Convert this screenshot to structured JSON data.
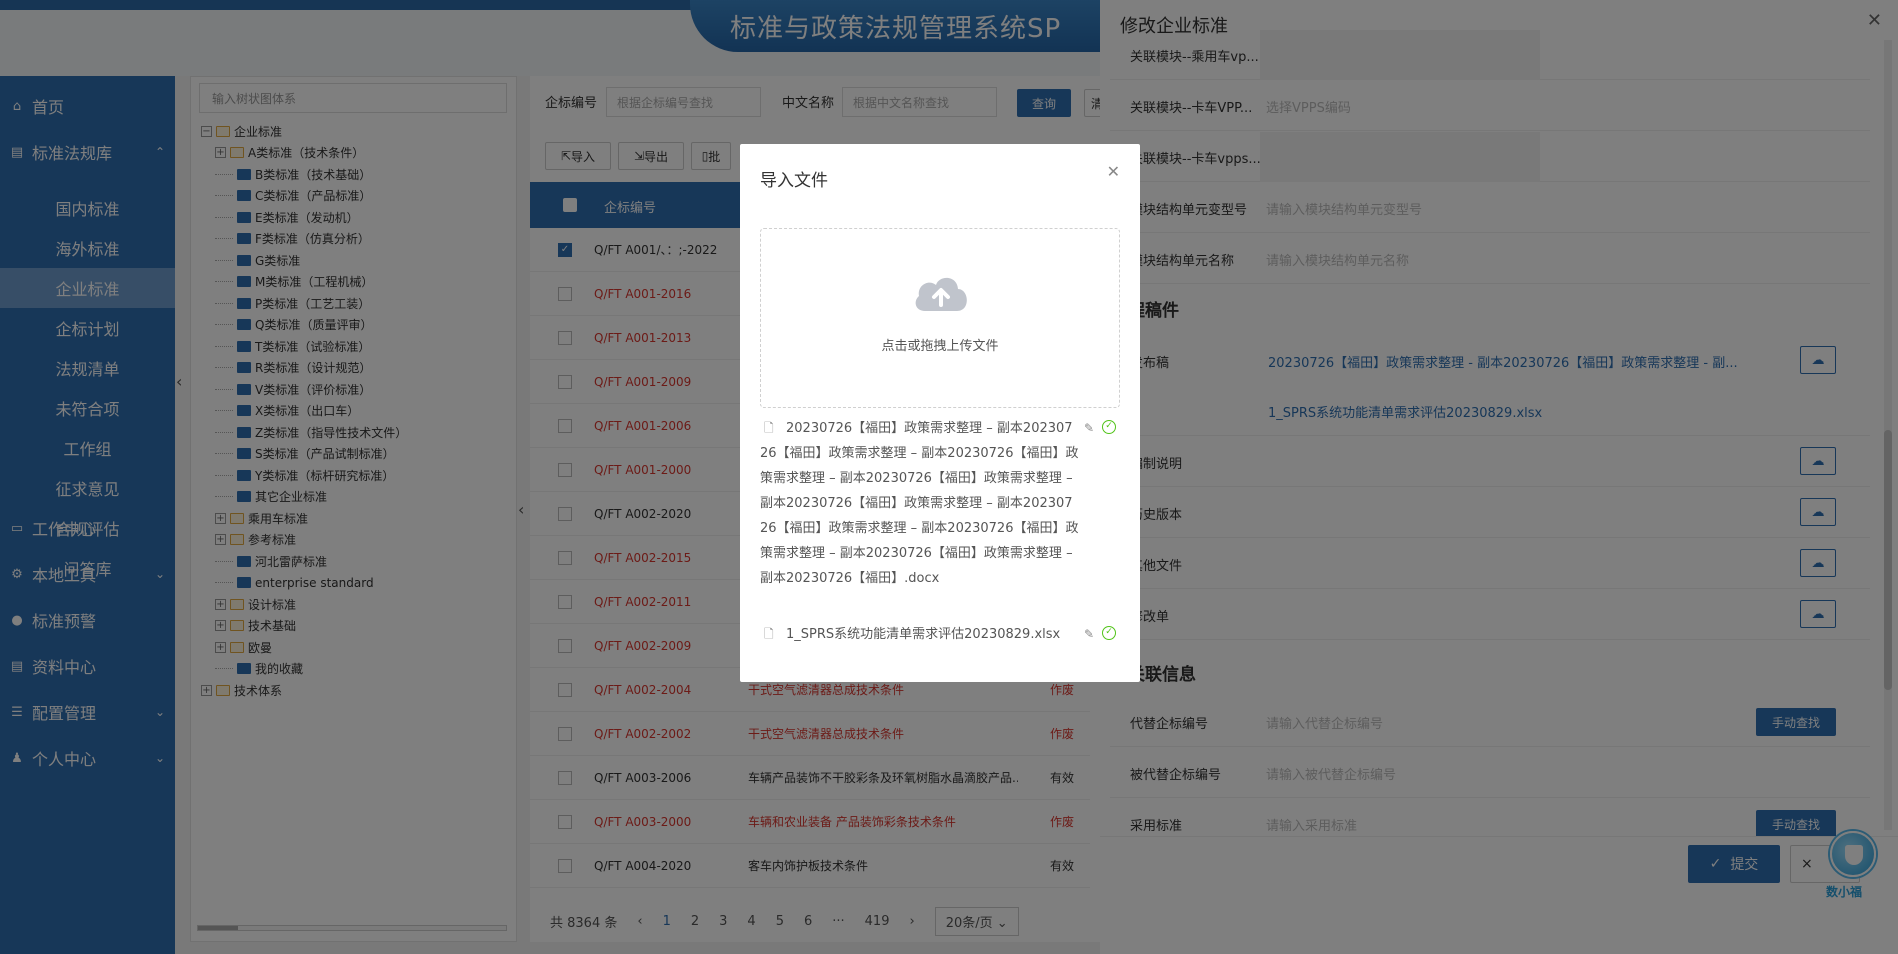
{
  "app": {
    "title": "标准与政策法规管理系统SP"
  },
  "sidebar": {
    "items": [
      {
        "icon": "home-icon",
        "label": "首页",
        "glyph": "⌂"
      },
      {
        "icon": "book-icon",
        "label": "标准法规库",
        "glyph": "▤",
        "expanded": true
      },
      {
        "icon": "monitor-icon",
        "label": "工作中心",
        "glyph": "▭"
      },
      {
        "icon": "gear-icon",
        "label": "本地工具",
        "glyph": "⚙"
      },
      {
        "icon": "alert-icon",
        "label": "标准预警",
        "glyph": "●"
      },
      {
        "icon": "document-icon",
        "label": "资料中心",
        "glyph": "▤"
      },
      {
        "icon": "sliders-icon",
        "label": "配置管理",
        "glyph": "☰"
      },
      {
        "icon": "person-icon",
        "label": "个人中心",
        "glyph": "♟"
      }
    ],
    "subitems": [
      "国内标准",
      "海外标准",
      "企业标准",
      "企标计划",
      "法规清单",
      "未符合项",
      "工作组",
      "征求意见",
      "合规评估",
      "问答库"
    ],
    "active_subitem": "企业标准"
  },
  "tree": {
    "search_placeholder": "输入树状图体系",
    "nodes": [
      "企业标准",
      "A类标准（技术条件）",
      "B类标准（技术基础）",
      "C类标准（产品标准）",
      "E类标准（发动机）",
      "F类标准（仿真分析）",
      "G类标准",
      "M类标准（工程机械）",
      "P类标准（工艺工装）",
      "Q类标准（质量评审）",
      "T类标准（试验标准）",
      "R类标准（设计规范）",
      "V类标准（评价标准）",
      "X类标准（出口车）",
      "Z类标准（指导性技术文件）",
      "S类标准（产品试制标准）",
      "Y类标准（标杆研究标准）",
      "其它企业标准",
      "乘用车标准",
      "参考标准",
      "河北雷萨标准",
      "enterprise standard",
      "设计标准",
      "技术基础",
      "欧曼",
      "我的收藏",
      "技术体系"
    ]
  },
  "search": {
    "code_label": "企标编号",
    "code_placeholder": "根据企标编号查找",
    "name_label": "中文名称",
    "name_placeholder": "根据中文名称查找",
    "query_button": "查询",
    "cut_button": "清"
  },
  "toolbar": {
    "import": "导入",
    "export": "导出",
    "batch": "批"
  },
  "table": {
    "header_code": "企标编号",
    "rows": [
      {
        "code": "Q/FT A001/、：;-2022",
        "name": "",
        "status": "",
        "red": false,
        "checked": true
      },
      {
        "code": "Q/FT A001-2016",
        "name": "",
        "status": "",
        "red": true
      },
      {
        "code": "Q/FT A001-2013",
        "name": "",
        "status": "",
        "red": true
      },
      {
        "code": "Q/FT A001-2009",
        "name": "",
        "status": "",
        "red": true
      },
      {
        "code": "Q/FT A001-2006",
        "name": "",
        "status": "",
        "red": true
      },
      {
        "code": "Q/FT A001-2000",
        "name": "",
        "status": "",
        "red": true
      },
      {
        "code": "Q/FT A002-2020",
        "name": "",
        "status": "",
        "red": false
      },
      {
        "code": "Q/FT A002-2015",
        "name": "",
        "status": "",
        "red": true
      },
      {
        "code": "Q/FT A002-2011",
        "name": "",
        "status": "",
        "red": true
      },
      {
        "code": "Q/FT A002-2009",
        "name": "",
        "status": "",
        "red": true
      },
      {
        "code": "Q/FT A002-2004",
        "name": "干式空气滤清器总成技术条件",
        "status": "作废",
        "red": true
      },
      {
        "code": "Q/FT A002-2002",
        "name": "干式空气滤清器总成技术条件",
        "status": "作废",
        "red": true
      },
      {
        "code": "Q/FT A003-2006",
        "name": "车辆产品装饰不干胶彩条及环氧树脂水晶滴胶产品...",
        "status": "有效",
        "red": false
      },
      {
        "code": "Q/FT A003-2000",
        "name": "车辆和农业装备 产品装饰彩条技术条件",
        "status": "作废",
        "red": true
      },
      {
        "code": "Q/FT A004-2020",
        "name": "客车内饰护板技术条件",
        "status": "有效",
        "red": false
      }
    ]
  },
  "pager": {
    "total": "共 8364 条",
    "pages": [
      "1",
      "2",
      "3",
      "4",
      "5",
      "6",
      "···",
      "419"
    ],
    "active": "1",
    "prev": "‹",
    "next": "›",
    "size": "20条/页 ⌄"
  },
  "drawer": {
    "title": "修改企业标准",
    "rows": [
      {
        "label": "关联模块--乘用车vp...",
        "placeholder": "",
        "grey": true
      },
      {
        "label": "关联模块--卡车VPP...",
        "placeholder": "选择VPPS编码",
        "grey": false
      },
      {
        "label": "关联模块--卡车vpps...",
        "placeholder": "",
        "grey": true
      },
      {
        "label": "模块结构单元变型号",
        "placeholder": "请输入模块结构单元变型号",
        "grey": false
      },
      {
        "label": "模块结构单元名称",
        "placeholder": "请输入模块结构单元名称",
        "grey": false
      }
    ],
    "section_files": "程稿件",
    "publish_label": "发布稿",
    "publish_file1": "20230726【福田】政策需求整理 - 副本20230726【福田】政策需求整理 - 副...",
    "publish_file2": "1_SPRS系统功能清单需求评估20230829.xlsx",
    "file_rows": [
      "编制说明",
      "历史版本",
      "其他文件",
      "修改单"
    ],
    "section_related": "关联信息",
    "related_rows": [
      {
        "label": "代替企标编号",
        "placeholder": "请输入代替企标编号",
        "button": "手动查找"
      },
      {
        "label": "被代替企标编号",
        "placeholder": "请输入被代替企标编号",
        "button": ""
      },
      {
        "label": "采用标准",
        "placeholder": "请输入采用标准",
        "button": "手动查找"
      }
    ],
    "submit": "提交",
    "cancel_icon": "×",
    "mascot_label": "数小福"
  },
  "modal": {
    "title": "导入文件",
    "upload_hint": "点击或拖拽上传文件",
    "files": [
      "20230726【福田】政策需求整理 – 副本20230726【福田】政策需求整理 – 副本20230726【福田】政策需求整理 – 副本20230726【福田】政策需求整理 – 副本20230726【福田】政策需求整理 – 副本20230726【福田】政策需求整理 – 副本20230726【福田】政策需求整理 – 副本20230726【福田】政策需求整理 – 副本20230726【福田】.docx",
      "1_SPRS系统功能清单需求评估20230829.xlsx"
    ]
  },
  "colors": {
    "primary": "#2f6fb1",
    "danger": "#d9362f",
    "success": "#52c41a"
  }
}
